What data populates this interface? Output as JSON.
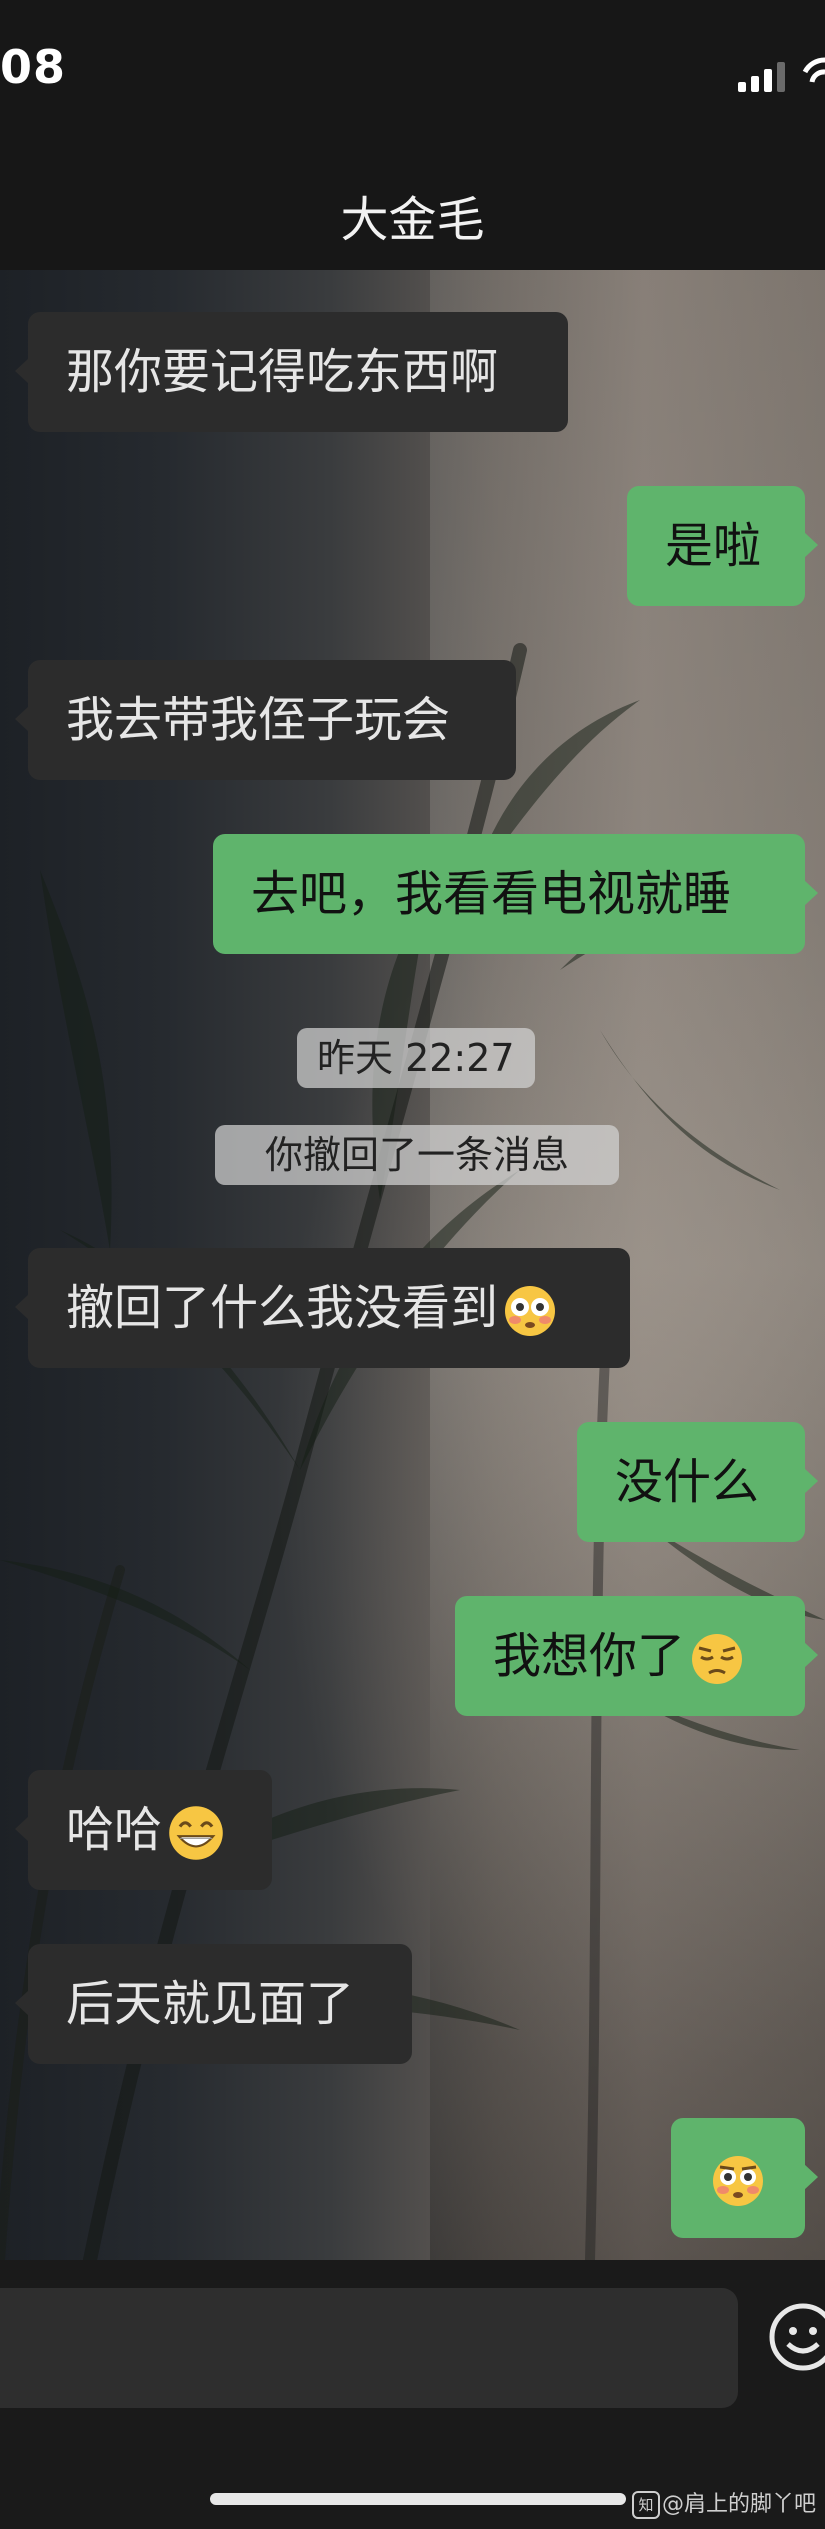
{
  "status_bar": {
    "time": "08"
  },
  "nav": {
    "title": "大金毛"
  },
  "messages": [
    {
      "text": "那你要记得吃东西啊"
    },
    {
      "text": "是啦"
    },
    {
      "text": "我去带我侄子玩会"
    },
    {
      "text": "去吧，我看看电视就睡"
    },
    {
      "timestamp": "昨天 22:27"
    },
    {
      "system": "你撤回了一条消息"
    },
    {
      "text": "撤回了什么我没看到",
      "emoji": "flushed-face"
    },
    {
      "text": "没什么"
    },
    {
      "text": "我想你了",
      "emoji": "pensive-face"
    },
    {
      "text": "哈哈",
      "emoji": "grinning-face"
    },
    {
      "text": "后天就见面了"
    },
    {
      "text": "",
      "emoji": "flushed-face"
    }
  ],
  "input": {
    "value": ""
  },
  "watermark": {
    "logo": "知",
    "text": "@肩上的脚丫吧"
  },
  "colors": {
    "outgoing_bubble": "#5fb46c",
    "incoming_bubble": "#2c2c2c",
    "bar_background": "#171717"
  }
}
